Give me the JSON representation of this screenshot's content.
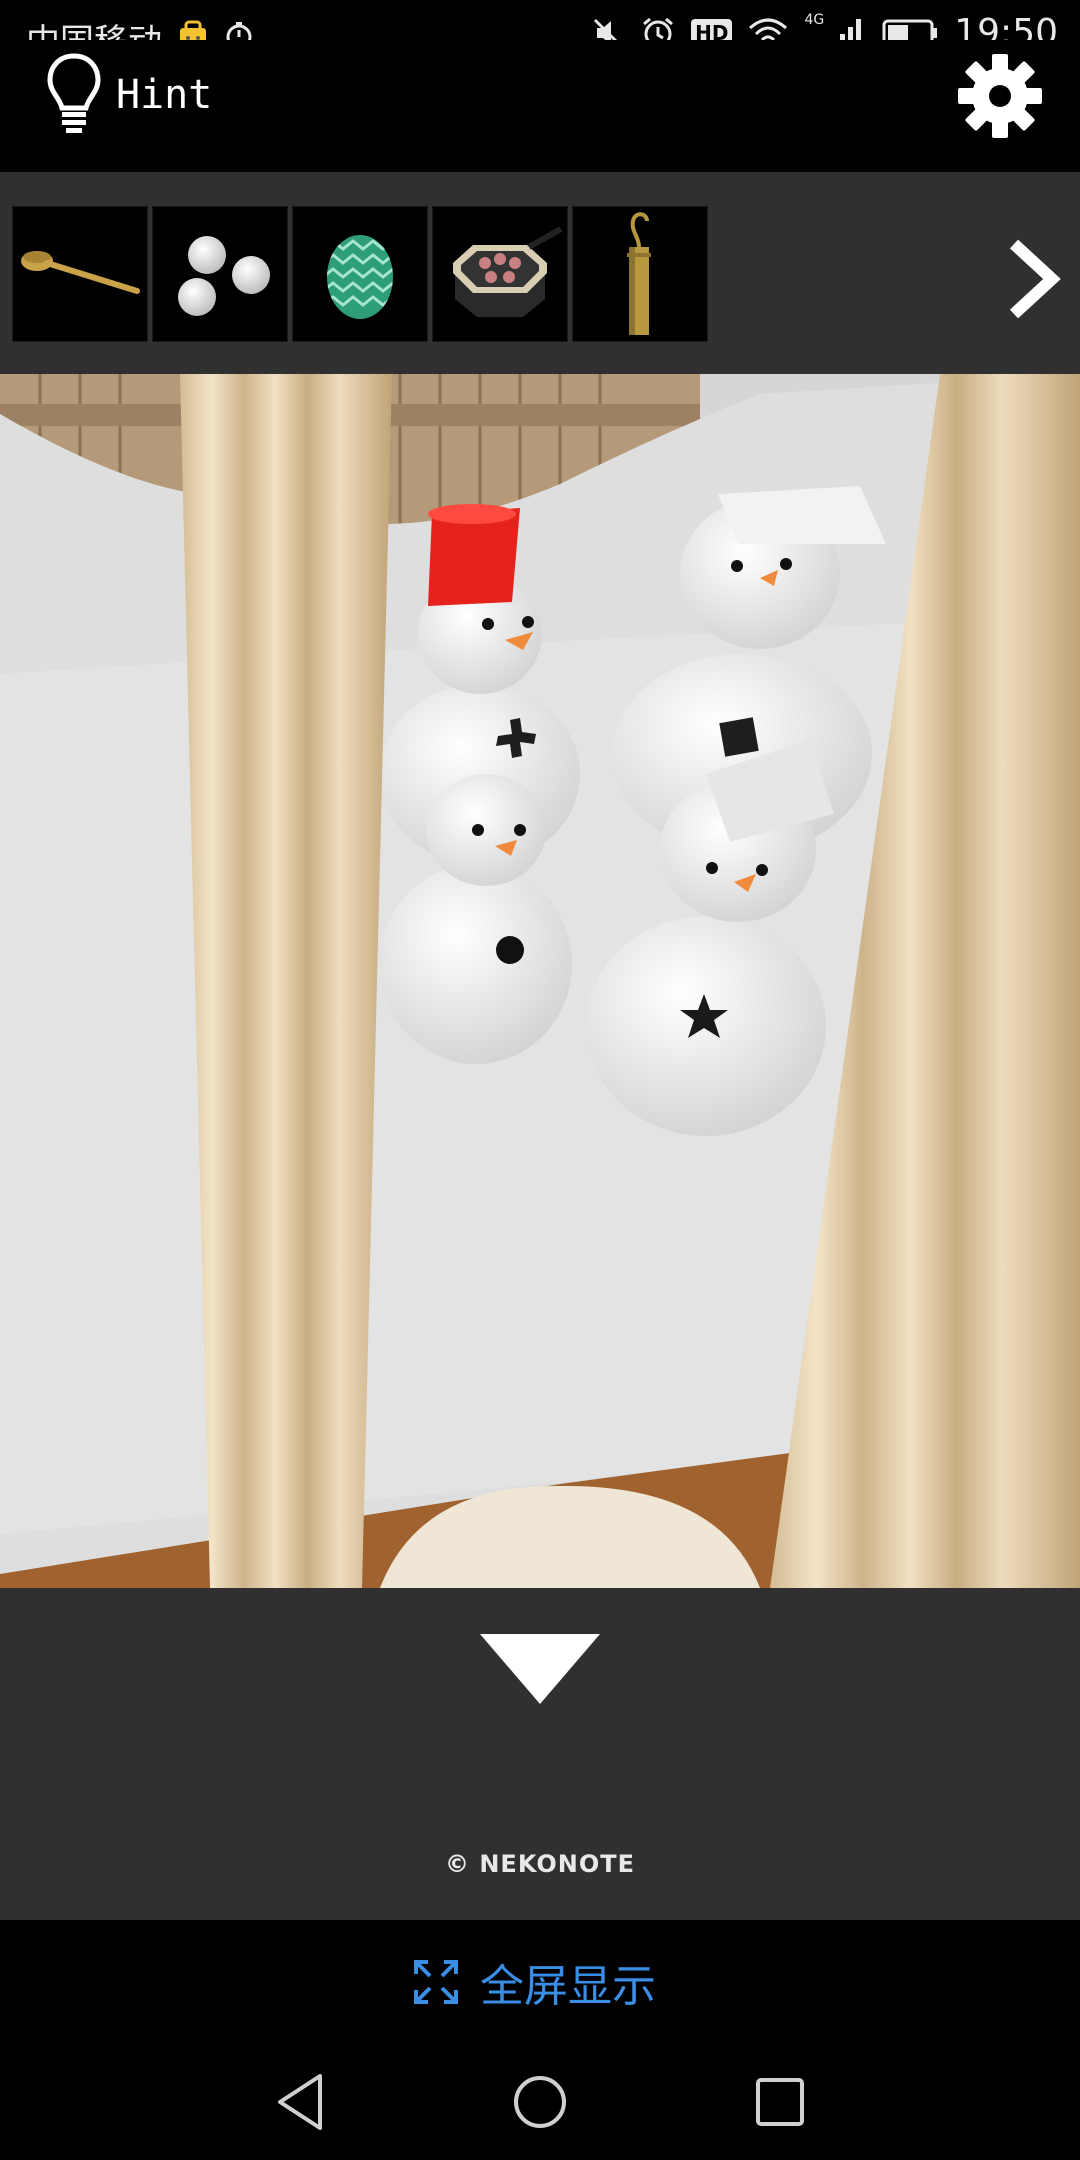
{
  "status_bar": {
    "carrier": "中国移动",
    "network": "4G",
    "hd": "HD",
    "time": "19:50"
  },
  "header": {
    "hint_label": "Hint",
    "hint_icon": "lightbulb-icon",
    "settings_icon": "gear-icon"
  },
  "inventory": {
    "items": [
      {
        "name": "ladle",
        "icon": "ladle-icon"
      },
      {
        "name": "snowballs",
        "icon": "snowballs-icon"
      },
      {
        "name": "green egg",
        "icon": "egg-icon"
      },
      {
        "name": "pan",
        "icon": "pan-icon"
      },
      {
        "name": "hook",
        "icon": "hook-icon"
      }
    ],
    "next_icon": "chevron-right-icon"
  },
  "bottom": {
    "down_icon": "triangle-down-icon",
    "copyright": "© NEKONOTE"
  },
  "fullscreen": {
    "label": "全屏显示",
    "icon": "expand-icon"
  },
  "nav": {
    "back_icon": "back-icon",
    "home_icon": "home-icon",
    "recents_icon": "recents-icon"
  },
  "colors": {
    "panel": "#303030",
    "accent": "#3a8ee6",
    "hat_red": "#e5231c",
    "egg_green": "#2e9e78"
  }
}
